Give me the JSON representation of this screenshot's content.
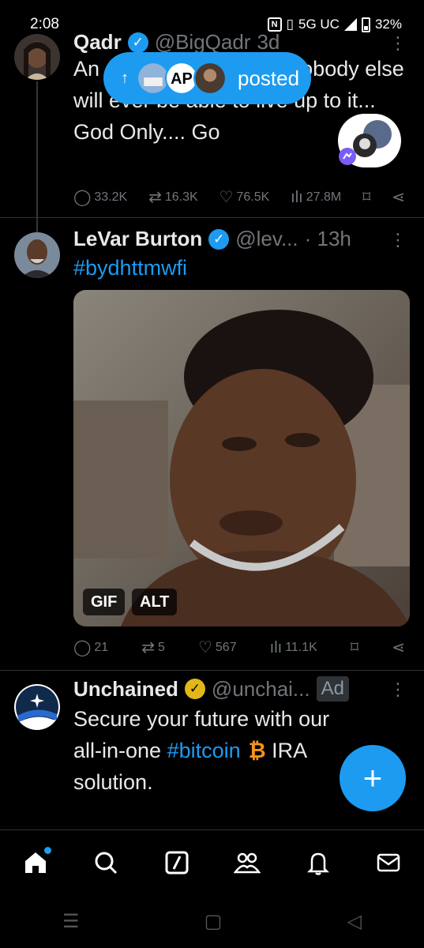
{
  "status_bar": {
    "time": "2:08",
    "network": "5G UC",
    "battery": "32%"
  },
  "tweet1": {
    "name": "Qadr",
    "handle": "@BigQadr",
    "time": "3d",
    "text": "An ... role so hard that nobody else will ever be able to live up to it... God Only.... Go",
    "replies": "33.2K",
    "retweets": "16.3K",
    "likes": "76.5K",
    "views": "27.8M"
  },
  "posted_pill": {
    "label": "posted"
  },
  "tweet2": {
    "name": "LeVar Burton",
    "handle": "@lev...",
    "time": "· 13h",
    "hashtag": "#bydhttmwfi",
    "gif_badge": "GIF",
    "alt_badge": "ALT",
    "replies": "21",
    "retweets": "5",
    "likes": "567",
    "views": "11.1K"
  },
  "tweet3": {
    "name": "Unchained",
    "handle": "@unchai...",
    "ad_label": "Ad",
    "text_line1": "Secure your future with our",
    "text_line2a": "all-in-one ",
    "hashtag": "#bitcoin",
    "text_line2b": " IRA",
    "text_line3": "solution."
  },
  "colors": {
    "accent": "#1d9bf0",
    "muted": "#71767b",
    "background": "#000000",
    "gold": "#e2b719"
  },
  "icons": [
    "home-icon",
    "search-icon",
    "grok-icon",
    "communities-icon",
    "notifications-icon",
    "messages-icon"
  ]
}
